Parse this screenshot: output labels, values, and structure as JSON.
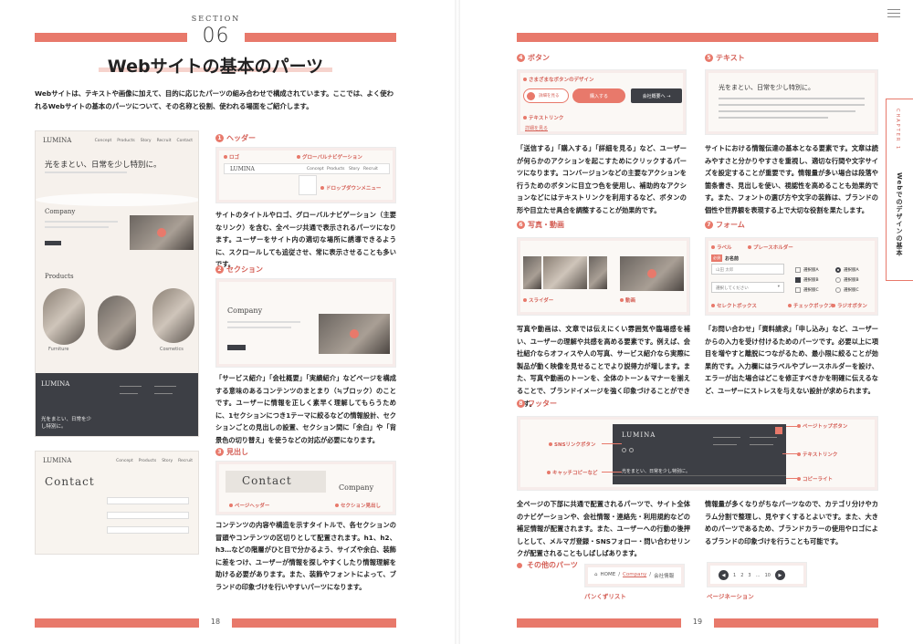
{
  "left_page": {
    "section_label": "SECTION",
    "section_number": "06",
    "title": "Webサイトの基本のパーツ",
    "intro": "Webサイトは、テキストや画像に加えて、目的に応じたパーツの組み合わせで構成されています。ここでは、よく使われるWebサイトの基本のパーツについて、その名称と役割、使われる場面をご紹介します。",
    "mock_site": {
      "brand": "LUMINA",
      "nav": [
        "Concept",
        "Products",
        "Story",
        "Recruit",
        "Contact"
      ],
      "hero_text": "光をまとい、日常を少し特別に。",
      "company_heading": "Company",
      "products_heading": "Products",
      "product_names": [
        "Furniture",
        "Cosmetics"
      ],
      "footer_text": "光をまとい、日常を少し特別に。",
      "contact_heading": "Contact"
    },
    "header_section": {
      "number": "1",
      "heading": "ヘッダー",
      "labels": {
        "logo": "ロゴ",
        "global_nav": "グローバルナビゲーション",
        "dropdown": "ドロップダウンメニュー"
      },
      "body": "サイトのタイトルやロゴ、グローバルナビゲーション（主要なリンク）を含む、全ページ共通で表示されるパーツになります。ユーザーをサイト内の適切な場所に誘導できるように、スクロールしても追従させ、常に表示させることも多いです。"
    },
    "section_section": {
      "number": "2",
      "heading": "セクション",
      "body": "「サービス紹介」「会社概要」「実績紹介」などページを構成する意味のあるコンテンツのまとまり（≒ブロック）のことです。ユーザーに情報を正しく素早く理解してもらうために、1セクションにつき1テーマに絞るなどの情報設計、セクションごとの見出しの設置、セクション間に「余白」や「背景色の切り替え」を使うなどの対応が必要になります。"
    },
    "heading_section": {
      "number": "3",
      "heading": "見出し",
      "labels": {
        "page_header": "ページヘッダー",
        "section_heading": "セクション見出し"
      },
      "sample_contact": "Contact",
      "sample_company": "Company",
      "body": "コンテンツの内容や構造を示すタイトルで、各セクションの冒頭やコンテンツの区切りとして配置されます。h1、h2、h3…などの階層がひと目で分かるよう、サイズや余白、装飾に差をつけ、ユーザーが情報を探しやすくしたり情報理解を助ける必要があります。また、装飾やフォントによって、ブランドの印象づけを行いやすいパーツになります。"
    },
    "page_number": "18"
  },
  "right_page": {
    "button_section": {
      "number": "4",
      "heading": "ボタン",
      "labels": {
        "variants": "さまざまなボタンのデザイン",
        "text_link": "テキストリンク"
      },
      "buttons": [
        "詳細を見る",
        "購入する",
        "会社概要へ →"
      ],
      "link_text": "詳細を見る",
      "body": "「送信する」「購入する」「詳細を見る」など、ユーザーが何らかのアクションを起こすためにクリックするパーツになります。コンバージョンなどの主要なアクションを行うためのボタンに目立つ色を使用し、補助的なアクションなどにはテキストリンクを利用するなど、ボタンの形や目立たせ具合を調整することが効果的です。"
    },
    "text_section": {
      "number": "5",
      "heading": "テキスト",
      "sample_heading": "光をまとい、日常を少し特別に。",
      "body": "サイトにおける情報伝達の基本となる要素です。文章は読みやすさと分かりやすさを重視し、適切な行間や文字サイズを設定することが重要です。情報量が多い場合は段落や箇条書き、見出しを使い、視認性を高めることも効果的です。また、フォントの選び方や文字の装飾は、ブランドの個性や世界観を表現する上で大切な役割を果たします。"
    },
    "media_section": {
      "number": "6",
      "heading": "写真・動画",
      "labels": {
        "slider": "スライダー",
        "video": "動画"
      },
      "body": "写真や動画は、文章では伝えにくい雰囲気や臨場感を補い、ユーザーの理解や共感を高める要素です。例えば、会社紹介ならオフィスや人の写真、サービス紹介なら実際に製品が動く映像を見せることでより説得力が増します。また、写真や動画のトーンを、全体のトーン＆マナーを揃えることで、ブランドイメージを強く印象づけることができます。"
    },
    "form_section": {
      "number": "7",
      "heading": "フォーム",
      "labels": {
        "label": "ラベル",
        "placeholder": "プレースホルダー",
        "select": "セレクトボックス",
        "checkbox": "チェックボックス",
        "radio": "ラジオボタン"
      },
      "required": "必須",
      "field_label": "お名前",
      "field_placeholder": "山田 太郎",
      "select_placeholder": "選択してください",
      "options": [
        "選択肢A",
        "選択肢B",
        "選択肢C"
      ],
      "body": "「お問い合わせ」「資料請求」「申し込み」など、ユーザーからの入力を受け付けるためのパーツです。必要以上に項目を増やすと離脱につながるため、最小限に絞ることが効果的です。入力欄にはラベルやプレースホルダーを設け、エラーが出た場合はどこを修正すべきかを明確に伝えるなど、ユーザーにストレスを与えない設計が求められます。"
    },
    "footer_section": {
      "number": "8",
      "heading": "フッター",
      "labels": {
        "sns": "SNSリンクボタン",
        "catch": "キャッチコピーなど",
        "page_top": "ページトップボタン",
        "text_link": "テキストリンク",
        "copyright": "コピーライト"
      },
      "brand": "LUMINA",
      "catch_text": "光をまとい、日常を少し特別に。",
      "body_left": "全ページの下部に共通で配置されるパーツで、サイト全体のナビゲーションや、会社情報・連絡先・利用規約などの補足情報が配置されます。また、ユーザーへの行動の後押しとして、メルマガ登録・SNSフォロー・問い合わせリンクが配置されることもしばしばあります。",
      "body_right": "情報量が多くなりがちなパーツなので、カテゴリ分けやカラム分割で整理し、見やすくするとよいです。また、大きめのパーツであるため、ブランドカラーの使用やロゴによるブランドの印象づけを行うことも可能です。"
    },
    "other_section": {
      "heading": "その他のパーツ",
      "breadcrumb": [
        "HOME",
        "Company",
        "会社情報"
      ],
      "breadcrumb_label": "パンくずリスト",
      "pagination": [
        "1",
        "2",
        "3",
        "…",
        "10"
      ],
      "pagination_label": "ページネーション"
    },
    "side_tab": {
      "chapter": "CHAPTER 1",
      "title": "Webでのデザインの基本"
    },
    "page_number": "19"
  }
}
